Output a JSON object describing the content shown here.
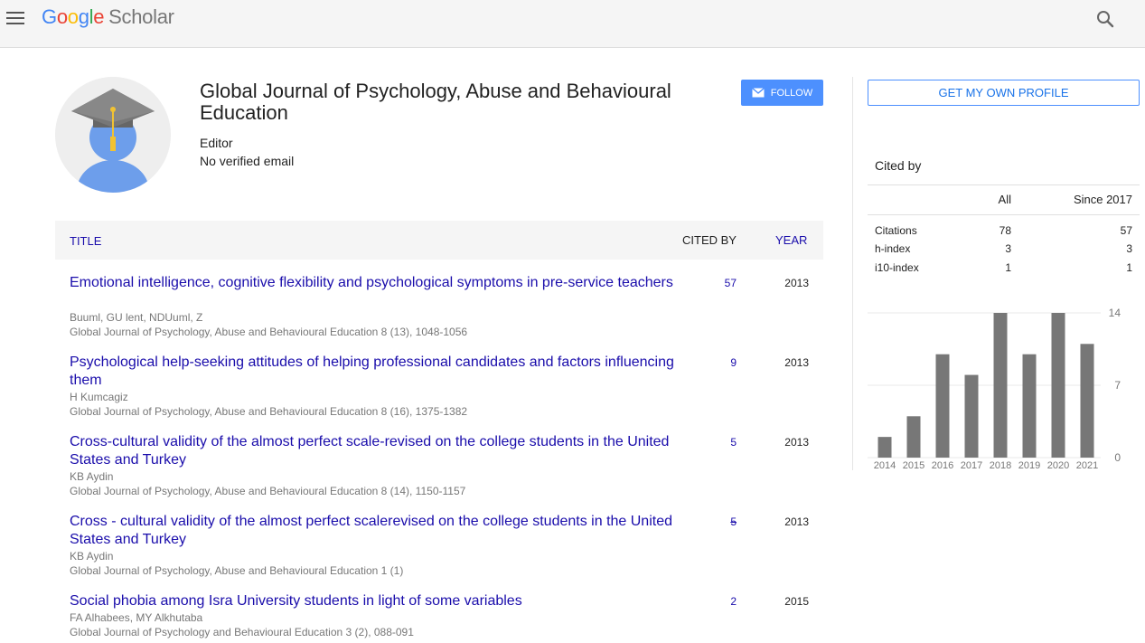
{
  "header": {
    "logo_letters": [
      "G",
      "o",
      "o",
      "g",
      "l",
      "e"
    ],
    "logo_product": "Scholar"
  },
  "profile": {
    "name": "Global Journal of Psychology, Abuse and Behavioural Education",
    "role": "Editor",
    "email": "No verified email",
    "follow_label": "FOLLOW"
  },
  "table": {
    "col_title": "TITLE",
    "col_cited_by": "CITED BY",
    "col_year": "YEAR",
    "rows": [
      {
        "title": "Emotional intelligence, cognitive flexibility and psychological symptoms in pre-service teachers",
        "authors": "Buuml, GU lent, NDUuml, Z",
        "venue": "Global Journal of Psychology, Abuse and Behavioural Education 8 (13), 1048-1056",
        "cited_by": "57",
        "year": "2013"
      },
      {
        "title": "Psychological help-seeking attitudes of helping professional candidates and factors influencing them",
        "authors": "H Kumcagiz",
        "venue": "Global Journal of Psychology, Abuse and Behavioural Education 8 (16), 1375-1382",
        "cited_by": "9",
        "year": "2013"
      },
      {
        "title": "Cross-cultural validity of the almost perfect scale-revised on the college students in the United States and Turkey",
        "authors": "KB Aydin",
        "venue": "Global Journal of Psychology, Abuse and Behavioural Education 8 (14), 1150-1157",
        "cited_by": "5",
        "year": "2013"
      },
      {
        "title": "Cross - cultural validity of the almost perfect scalerevised on the college students in the United States and Turkey",
        "authors": "KB Aydin",
        "venue": "Global Journal of Psychology, Abuse and Behavioural Education 1 (1)",
        "cited_by": "5",
        "year": "2013"
      },
      {
        "title": "Social phobia among Isra University students in light of some variables",
        "authors": "FA Alhabees, MY Alkhutaba",
        "venue": "Global Journal of Psychology and Behavioural Education 3 (2), 088-091",
        "cited_by": "2",
        "year": "2015"
      }
    ]
  },
  "sidebar": {
    "own_profile_label": "GET MY OWN PROFILE",
    "cited_by_title": "Cited by",
    "col_all": "All",
    "col_since": "Since 2017",
    "stats": [
      {
        "label": "Citations",
        "all": "78",
        "since": "57"
      },
      {
        "label": "h-index",
        "all": "3",
        "since": "3"
      },
      {
        "label": "i10-index",
        "all": "1",
        "since": "1"
      }
    ]
  },
  "chart_data": {
    "type": "bar",
    "categories": [
      "2014",
      "2015",
      "2016",
      "2017",
      "2018",
      "2019",
      "2020",
      "2021"
    ],
    "values": [
      2,
      4,
      10,
      8,
      14,
      10,
      14,
      11
    ],
    "yticks": [
      0,
      7,
      14
    ],
    "ylim": [
      0,
      14
    ],
    "bar_color": "#777777"
  }
}
